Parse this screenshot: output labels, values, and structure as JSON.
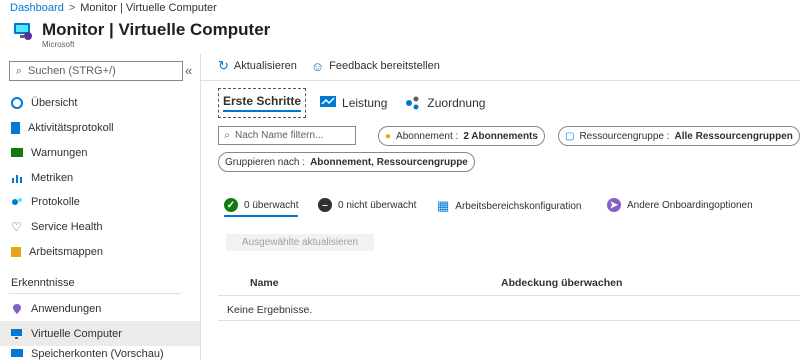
{
  "breadcrumb": {
    "home": "Dashboard",
    "separator": ">",
    "current": "Monitor | Virtuelle Computer"
  },
  "header": {
    "title": "Monitor | Virtuelle Computer",
    "subtitle": "Microsoft"
  },
  "sidebar": {
    "search_placeholder": "Suchen (STRG+/)",
    "collapse": "«",
    "items": [
      {
        "label": "Übersicht",
        "icon": "overview-icon"
      },
      {
        "label": "Aktivitätsprotokoll",
        "icon": "activity-log-icon"
      },
      {
        "label": "Warnungen",
        "icon": "alerts-icon"
      },
      {
        "label": "Metriken",
        "icon": "metrics-icon"
      },
      {
        "label": "Protokolle",
        "icon": "logs-icon"
      },
      {
        "label": "Service Health",
        "icon": "heart-icon"
      },
      {
        "label": "Arbeitsmappen",
        "icon": "workbooks-icon"
      }
    ],
    "section_title": "Erkenntnisse",
    "insights": [
      {
        "label": "Anwendungen",
        "icon": "pin-icon"
      },
      {
        "label": "Virtuelle Computer",
        "icon": "vm-icon"
      },
      {
        "label": "Speicherkonten (Vorschau)",
        "icon": "storage-icon"
      }
    ]
  },
  "toolbar": {
    "refresh": "Aktualisieren",
    "feedback": "Feedback bereitstellen"
  },
  "tabs": [
    "Erste Schritte",
    "Leistung",
    "Zuordnung"
  ],
  "filters": {
    "search_placeholder": "Nach Name filtern...",
    "subscription_label": "Abonnement :",
    "subscription_value": "2 Abonnements",
    "resourcegroup_label": "Ressourcengruppe :",
    "resourcegroup_value": "Alle Ressourcengruppen",
    "groupby_label": "Gruppieren nach :",
    "groupby_value": "Abonnement, Ressourcengruppe"
  },
  "status": {
    "monitored": "0 überwacht",
    "unmonitored": "0 nicht überwacht",
    "workspace": "Arbeitsbereichskonfiguration",
    "other": "Andere Onboardingoptionen"
  },
  "update_button": "Ausgewählte aktualisieren",
  "table": {
    "col_name": "Name",
    "col_coverage": "Abdeckung überwachen",
    "empty": "Keine Ergebnisse."
  },
  "colors": {
    "accent": "#0078d4",
    "green": "#107c10",
    "purple": "#8661c5"
  }
}
